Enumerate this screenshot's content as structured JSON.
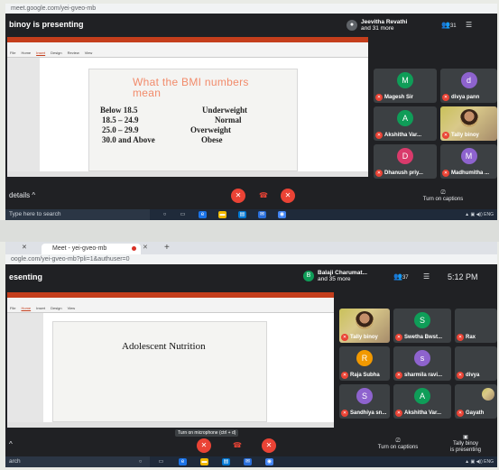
{
  "top": {
    "url": "meet.google.com/yei-gveo-mb",
    "presenter_banner": "binoy is presenting",
    "user_name": "Jeevitha Revathi",
    "user_more": "and 31 more",
    "people_count": "31",
    "slide": {
      "title_line1": "What the BMI numbers",
      "title_line2": "mean",
      "rows": [
        {
          "range": "Below 18.5",
          "label": "Underweight"
        },
        {
          "range": "18.5 – 24.9",
          "label": "Normal"
        },
        {
          "range": "25.0 – 29.9",
          "label": "Overweight"
        },
        {
          "range": "30.0 and Above",
          "label": "Obese"
        }
      ]
    },
    "tiles": [
      {
        "name": "Magesh Sir",
        "initial": "M",
        "color": "#0f9d58"
      },
      {
        "name": "divya pann",
        "initial": "d",
        "color": "#8e63ce"
      },
      {
        "name": "Akshitha Var...",
        "initial": "A",
        "color": "#0f9d58"
      },
      {
        "name": "Tally binoy",
        "initial": "",
        "color": "#3c4043"
      },
      {
        "name": "Dhanush priy...",
        "initial": "D",
        "color": "#d93a6b"
      },
      {
        "name": "Madhumitha ...",
        "initial": "M",
        "color": "#8e63ce"
      }
    ],
    "details_label": "details",
    "captions_label": "Turn on captions",
    "search_label": "Type here to search"
  },
  "bottom": {
    "url": "oogle.com/yei-gveo-mb?pli=1&authuser=0",
    "tab_label": "Meet - yei-gveo-mb",
    "presenter_banner": "esenting",
    "user_name": "Balaji Charumat...",
    "user_more": "and 35 more",
    "user_initial": "B",
    "people_count": "37",
    "clock": "5:12 PM",
    "slide": {
      "title": "Adolescent  Nutrition"
    },
    "tiles": [
      {
        "name": "Tally binoy",
        "initial": "",
        "color": "#3c4043"
      },
      {
        "name": "Swetha Bwst...",
        "initial": "S",
        "color": "#0f9d58"
      },
      {
        "name": "Rax",
        "initial": "",
        "color": "#3c4043"
      },
      {
        "name": "Raja Subha",
        "initial": "R",
        "color": "#f29900"
      },
      {
        "name": "sharmila ravi...",
        "initial": "s",
        "color": "#8e63ce"
      },
      {
        "name": "divya",
        "initial": "",
        "color": "#3c4043"
      },
      {
        "name": "Sandhiya sn...",
        "initial": "S",
        "color": "#8e63ce"
      },
      {
        "name": "Akshitha Var...",
        "initial": "A",
        "color": "#0f9d58"
      },
      {
        "name": "Gayath",
        "initial": "",
        "color": "#3c4043"
      }
    ],
    "mic_tooltip": "Turn on microphone (ctrl + d)",
    "captions_label": "Turn on captions",
    "presenting_label_line1": "Tally binoy",
    "presenting_label_line2": "is presenting",
    "search_label": "arch"
  },
  "colors": {
    "meet_bg": "#202124",
    "tile_bg": "#3c4043",
    "danger": "#ea4335",
    "slide_accent": "#f28b6b"
  }
}
